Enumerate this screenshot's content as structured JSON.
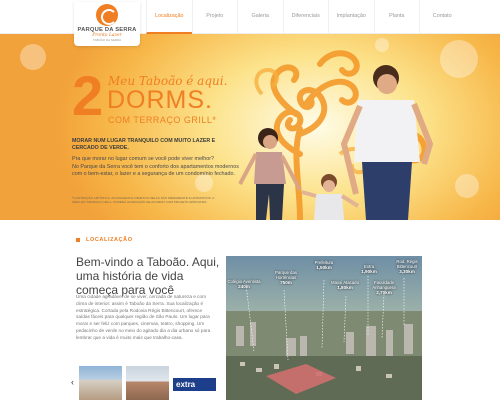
{
  "header": {
    "logo": {
      "name": "PARQUE DA SERRA",
      "tagline": "Pronto Lazer",
      "sub": "TABOÃO DA SERRA"
    },
    "nav": [
      {
        "label": "Localização",
        "active": true
      },
      {
        "label": "Projeto"
      },
      {
        "label": "Galeria"
      },
      {
        "label": "Diferenciais"
      },
      {
        "label": "Implantação"
      },
      {
        "label": "Planta"
      },
      {
        "label": "Contato"
      }
    ]
  },
  "hero": {
    "big_number": "2",
    "tagline": "Meu Taboão é aqui.",
    "dorms": "DORMS.",
    "terraco": "COM TERRAÇO GRILL*",
    "morar": "MORAR NUM LUGAR TRANQUILO COM MUITO LAZER E CERCADO DE VERDE.",
    "question": "Pra que morar no lugar comum se você pode viver melhor?",
    "description": "No Parque da Serra você tem o conforto dos apartamentos modernos com o bem-estar, o lazer e a segurança de um condomínio fechado.",
    "legal": "*ILUSTRAÇÃO ARTÍSTICA. AS IMAGENS E OBJETOS NELAS SÃO MERAMENTE ILUSTRATIVOS. A ÁREA DO TERRAÇO GRILL, PODERÁ ALTERAÇÃO DE ACORDO COM PROJETO APROVADO."
  },
  "location": {
    "section_label": "LOCALIZAÇÃO",
    "title": "Bem-vindo a Taboão. Aqui, uma história de vida começa para você",
    "body": "Uma cidade agradável de se viver, cercada de natureza e com clima de interior: assim é Taboão da Serra. Sua localização é estratégica. Cortada pela Rodovia Régis Bittencourt, oferece saídas fáceis para qualquer região de São Paulo. Um lugar para morar e ser feliz com parques, cinemas, teatro, shopping. Um pedacinho de verde no meio do agitado dia a dia urbano só para lembrar que a vida é muito mais que trabalho-casa.",
    "prev_icon": "‹",
    "thumb_sign": "extra",
    "map_labels": [
      {
        "name": "Colégio Aventista",
        "dist": "240m"
      },
      {
        "name": "Parque das Hortênsias",
        "dist": "750m"
      },
      {
        "name": "Prefeitura",
        "dist": "1,50km"
      },
      {
        "name": "Maxxi Atacado",
        "dist": "1,80km"
      },
      {
        "name": "Extra",
        "dist": "1,90km"
      },
      {
        "name": "Faculdade Anhanguera",
        "dist": "2,70km"
      },
      {
        "name": "Rod. Régis Bittencourt",
        "dist": "3,30km"
      }
    ]
  },
  "colors": {
    "accent": "#f07e22",
    "text_dark": "#444444",
    "text_muted": "#777777"
  }
}
